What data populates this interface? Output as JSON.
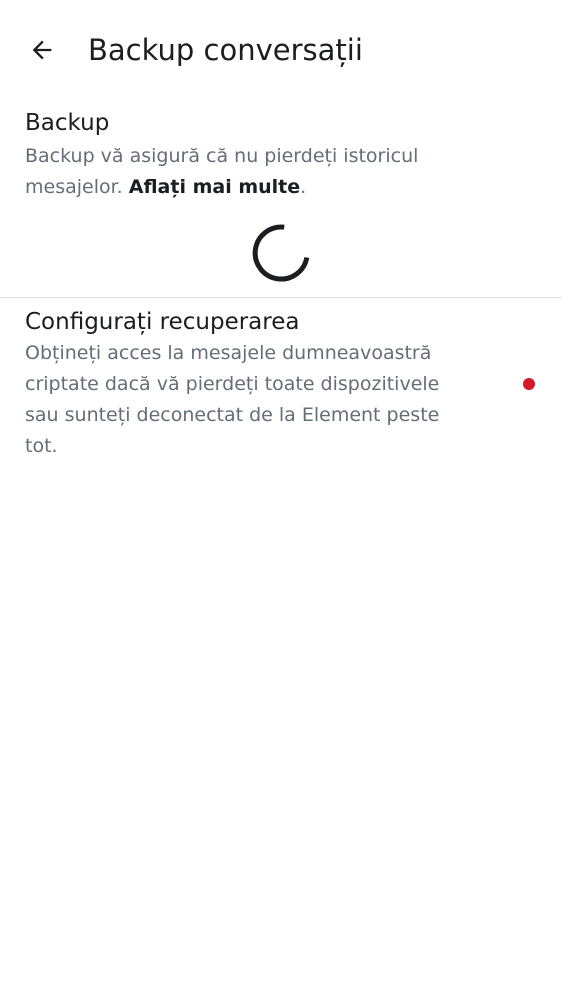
{
  "header": {
    "back_icon": "arrow-left-icon",
    "title": "Backup conversații"
  },
  "backup": {
    "title": "Backup",
    "description": "Backup vă asigură că nu pierdeți istoricul mesajelor. ",
    "learn_more": "Aflați mai multe",
    "suffix": ".",
    "status": "loading"
  },
  "recovery": {
    "title": "Configurați recuperarea",
    "description": "Obțineți acces la mesajele dumneavoastră criptate dacă vă pierdeți toate dispozitivele sau sunteți deconectat de la Element peste tot.",
    "indicator_color": "#d51928"
  },
  "colors": {
    "primary_text": "#1b1d22",
    "secondary_text": "#656d77",
    "divider": "#e1e4e8",
    "alert": "#d51928"
  }
}
